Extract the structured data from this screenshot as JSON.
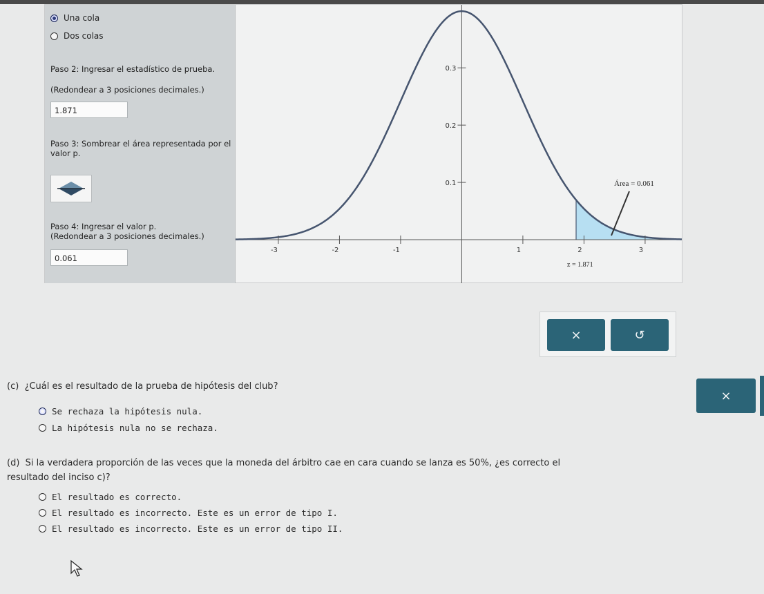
{
  "tails": {
    "options": [
      {
        "label": "Una cola",
        "selected": true
      },
      {
        "label": "Dos colas",
        "selected": false
      }
    ]
  },
  "step2": {
    "title": "Paso 2: Ingresar el estadístico de prueba.",
    "note": "(Redondear a 3 posiciones decimales.)",
    "value": "1.871"
  },
  "step3": {
    "title": "Paso 3: Sombrear el área representada por el valor p.",
    "shade_icon": "shade-tool-icon"
  },
  "step4": {
    "title": "Paso 4: Ingresar el valor p.",
    "note": "(Redondear a 3 posiciones decimales.)",
    "value": "0.061"
  },
  "chart_data": {
    "type": "area",
    "curve": "standard-normal",
    "x_ticks": [
      "-3",
      "-2",
      "-1",
      "1",
      "2",
      "3"
    ],
    "y_ticks": [
      "0.1",
      "0.2",
      "0.3"
    ],
    "xlim": [
      -3.7,
      3.6
    ],
    "ylim": [
      0,
      0.41
    ],
    "shade_from": 1.871,
    "shade_side": "right",
    "area_label": "Área = 0.061",
    "z_label": "z = 1.871",
    "colors": {
      "curve": "#46556f",
      "shade": "#b7dff2",
      "axis": "#555555"
    }
  },
  "toolbar": {
    "close_symbol": "×",
    "undo_symbol": "↺"
  },
  "question_c": {
    "prefix": "(c)",
    "text": "¿Cuál es el resultado de la prueba de hipótesis del club?",
    "options": [
      {
        "label": "Se rechaza la hipótesis nula.",
        "selected": true
      },
      {
        "label": "La hipótesis nula no se rechaza.",
        "selected": false
      }
    ],
    "close_symbol": "×"
  },
  "question_d": {
    "prefix": "(d)",
    "text_line1": "Si la verdadera proporción de las veces que la moneda del árbitro cae en cara cuando se lanza es 50%, ¿es correcto el",
    "text_line2": "resultado del inciso c)?",
    "options": [
      {
        "label": "El resultado es correcto.",
        "selected": false
      },
      {
        "label": "El resultado es incorrecto. Este es un error de tipo I.",
        "selected": false
      },
      {
        "label": "El resultado es incorrecto. Este es un error de tipo II.",
        "selected": false
      }
    ]
  },
  "colors": {
    "accent": "#2b6477",
    "panel": "#cfd3d5",
    "radio_selected": "#2d3b7a"
  }
}
